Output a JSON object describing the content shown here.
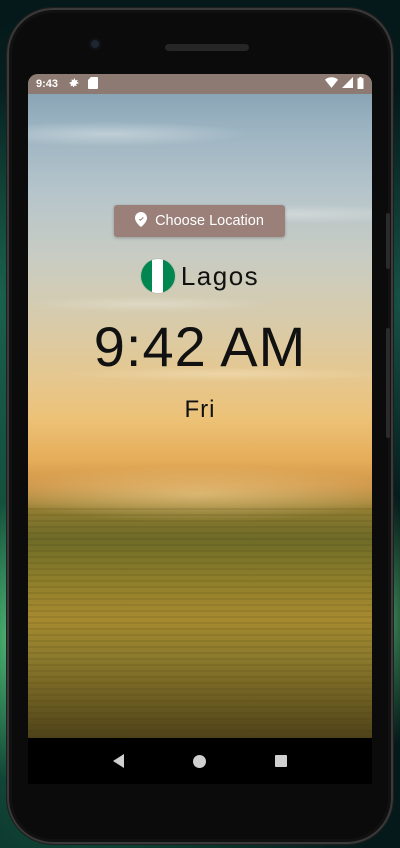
{
  "status_bar": {
    "time": "9:43",
    "left_icons": [
      "settings-icon",
      "sd-card-icon"
    ],
    "right_icons": [
      "wifi-icon",
      "signal-icon",
      "battery-icon"
    ]
  },
  "location_button": {
    "label": "Choose Location",
    "icon": "location-pin-icon"
  },
  "city": {
    "name": "Lagos",
    "flag": {
      "country": "Nigeria",
      "colors": [
        "#008751",
        "#ffffff",
        "#008751"
      ]
    }
  },
  "clock": {
    "time": "9:42 AM",
    "day": "Fri"
  },
  "nav_bar": {
    "buttons": [
      "back",
      "home",
      "recents"
    ]
  },
  "colors": {
    "status_bar": "#8d7b73",
    "button_bg": "#9a8079",
    "text": "#111111"
  }
}
